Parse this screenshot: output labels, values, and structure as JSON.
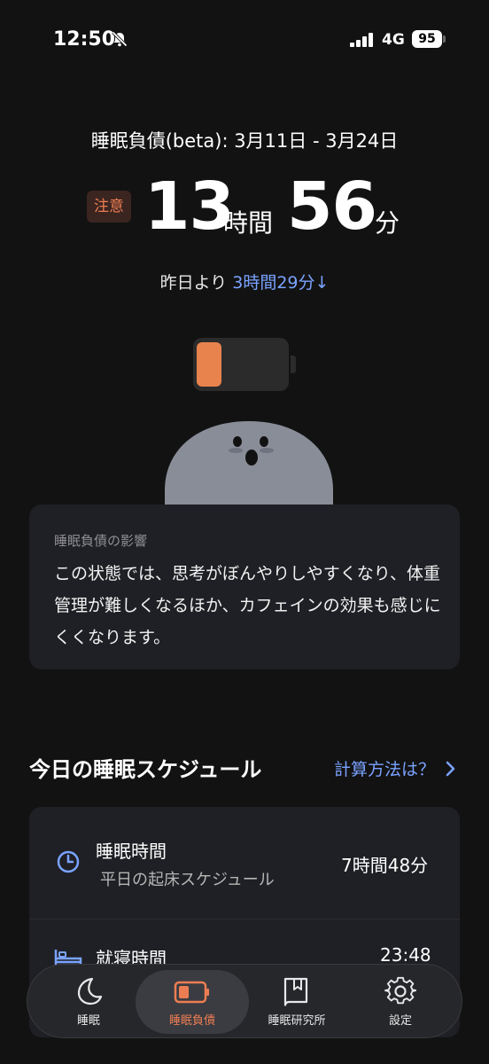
{
  "status_bar": {
    "time": "12:50",
    "network": "4G",
    "battery": "95"
  },
  "debt": {
    "range_label": "睡眠負債(beta): 3月11日 - 3月24日",
    "badge": "注意",
    "hours": "13",
    "hours_unit": "時間",
    "minutes": "56",
    "minutes_unit": "分",
    "compare_prefix": "昨日より",
    "compare_delta": "3時間29分↓",
    "battery_level": 0.28
  },
  "impact": {
    "title": "睡眠負債の影響",
    "body": "この状態では、思考がぼんやりしやすくなり、体重管理が難しくなるほか、カフェインの効果も感じにくくなります。"
  },
  "schedule": {
    "title": "今日の睡眠スケジュール",
    "link": "計算方法は？",
    "rows": [
      {
        "title": "睡眠時間",
        "subtitle": "平日の起床スケジュール",
        "value": "7時間48分"
      },
      {
        "title": "就寝時間",
        "value": "23:48"
      }
    ]
  },
  "tabs": [
    {
      "label": "睡眠",
      "icon": "moon-icon",
      "active": false
    },
    {
      "label": "睡眠負債",
      "icon": "battery-icon",
      "active": true
    },
    {
      "label": "睡眠研究所",
      "icon": "book-icon",
      "active": false
    },
    {
      "label": "設定",
      "icon": "gear-icon",
      "active": false
    }
  ],
  "colors": {
    "accent_orange": "#ec7d52",
    "link_blue": "#7aa3ff",
    "background": "#121212",
    "card": "#1f2025"
  }
}
